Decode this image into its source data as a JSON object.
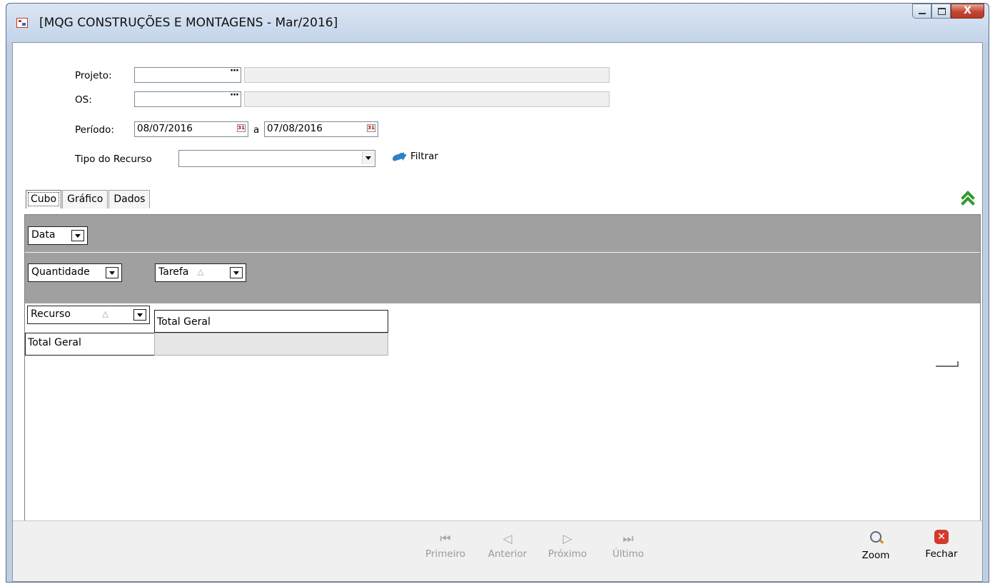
{
  "window": {
    "title": "[MQG CONSTRUÇÕES E MONTAGENS - Mar/2016]",
    "close_glyph": "X"
  },
  "form": {
    "projeto_label": "Projeto:",
    "projeto_value": "",
    "projeto_desc": "",
    "os_label": "OS:",
    "os_value": "",
    "os_desc": "",
    "periodo_label": "Período:",
    "periodo_start": "08/07/2016",
    "periodo_sep": "a",
    "periodo_end": "07/08/2016",
    "tipo_recurso_label": "Tipo do Recurso",
    "tipo_recurso_value": "",
    "filtrar_label": "Filtrar",
    "ellipsis_glyph": "···",
    "calendar_glyph": "31"
  },
  "tabs": [
    {
      "label": "Cubo",
      "active": true
    },
    {
      "label": "Gráfico",
      "active": false
    },
    {
      "label": "Dados",
      "active": false
    }
  ],
  "pivot": {
    "filter_field": "Data",
    "data_field": "Quantidade",
    "column_field": "Tarefa",
    "row_field": "Recurso",
    "column_total_header": "Total Geral",
    "row_total_header": "Total Geral",
    "grand_total_value": "",
    "sort_glyph": "△"
  },
  "navigation": {
    "first": {
      "label": "Primeiro",
      "glyph": "⏮"
    },
    "previous": {
      "label": "Anterior",
      "glyph": "◁"
    },
    "next": {
      "label": "Próximo",
      "glyph": "▷"
    },
    "last": {
      "label": "Último",
      "glyph": "⏭"
    }
  },
  "actions": {
    "zoom_label": "Zoom",
    "fechar_label": "Fechar",
    "fechar_glyph": "✕"
  }
}
